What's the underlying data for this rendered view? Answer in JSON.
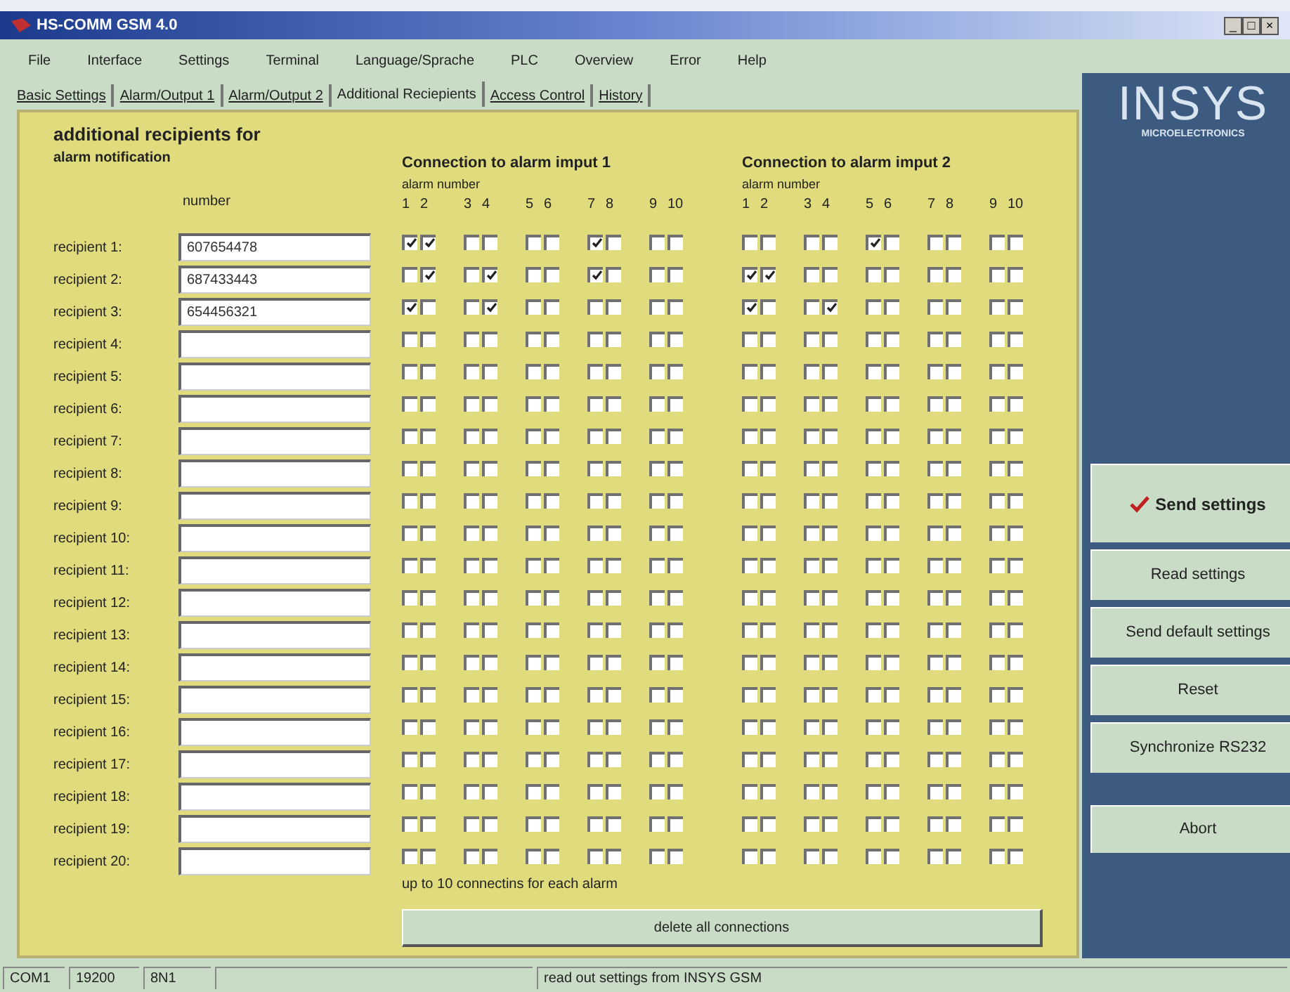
{
  "window": {
    "title": "HS-COMM GSM 4.0",
    "controls": [
      "_",
      "□",
      "×"
    ]
  },
  "menu": [
    "File",
    "Interface",
    "Settings",
    "Terminal",
    "Language/Sprache",
    "PLC",
    "Overview",
    "Error",
    "Help"
  ],
  "tabs": [
    {
      "label": "Basic Settings",
      "selected": false
    },
    {
      "label": "Alarm/Output 1",
      "selected": false
    },
    {
      "label": "Alarm/Output 2",
      "selected": false
    },
    {
      "label": "Additional Reciepients",
      "selected": true
    },
    {
      "label": "Access Control",
      "selected": false
    },
    {
      "label": "History",
      "selected": false
    }
  ],
  "heading": {
    "line_1": "additional recipients for",
    "line_2": "alarm notification"
  },
  "number_header": "number",
  "groups": [
    {
      "title": "Connection to alarm imput 1",
      "subtitle": "alarm number",
      "numbers": [
        "1",
        "2",
        "3",
        "4",
        "5",
        "6",
        "7",
        "8",
        "9",
        "10"
      ]
    },
    {
      "title": "Connection to alarm imput 2",
      "subtitle": "alarm number",
      "numbers": [
        "1",
        "2",
        "3",
        "4",
        "5",
        "6",
        "7",
        "8",
        "9",
        "10"
      ]
    }
  ],
  "recipients": [
    {
      "label": "recipient 1:",
      "number": "607654478",
      "connections": [
        [
          true,
          true,
          false,
          false,
          false,
          false,
          true,
          false,
          false,
          false
        ],
        [
          false,
          false,
          false,
          false,
          true,
          false,
          false,
          false,
          false,
          false
        ]
      ]
    },
    {
      "label": "recipient 2:",
      "number": "687433443",
      "connections": [
        [
          false,
          true,
          false,
          true,
          false,
          false,
          true,
          false,
          false,
          false
        ],
        [
          true,
          true,
          false,
          false,
          false,
          false,
          false,
          false,
          false,
          false
        ]
      ]
    },
    {
      "label": "recipient 3:",
      "number": "654456321",
      "connections": [
        [
          true,
          false,
          false,
          true,
          false,
          false,
          false,
          false,
          false,
          false
        ],
        [
          true,
          false,
          false,
          true,
          false,
          false,
          false,
          false,
          false,
          false
        ]
      ]
    },
    {
      "label": "recipient 4:",
      "connections": [
        [
          false,
          false,
          false,
          false,
          false,
          false,
          false,
          false,
          false,
          false
        ],
        [
          false,
          false,
          false,
          false,
          false,
          false,
          false,
          false,
          false,
          false
        ]
      ]
    },
    {
      "label": "recipient 5:",
      "connections": [
        [
          false,
          false,
          false,
          false,
          false,
          false,
          false,
          false,
          false,
          false
        ],
        [
          false,
          false,
          false,
          false,
          false,
          false,
          false,
          false,
          false,
          false
        ]
      ]
    },
    {
      "label": "recipient 6:",
      "connections": [
        [
          false,
          false,
          false,
          false,
          false,
          false,
          false,
          false,
          false,
          false
        ],
        [
          false,
          false,
          false,
          false,
          false,
          false,
          false,
          false,
          false,
          false
        ]
      ]
    },
    {
      "label": "recipient 7:",
      "connections": [
        [
          false,
          false,
          false,
          false,
          false,
          false,
          false,
          false,
          false,
          false
        ],
        [
          false,
          false,
          false,
          false,
          false,
          false,
          false,
          false,
          false,
          false
        ]
      ]
    },
    {
      "label": "recipient 8:",
      "connections": [
        [
          false,
          false,
          false,
          false,
          false,
          false,
          false,
          false,
          false,
          false
        ],
        [
          false,
          false,
          false,
          false,
          false,
          false,
          false,
          false,
          false,
          false
        ]
      ]
    },
    {
      "label": "recipient 9:",
      "connections": [
        [
          false,
          false,
          false,
          false,
          false,
          false,
          false,
          false,
          false,
          false
        ],
        [
          false,
          false,
          false,
          false,
          false,
          false,
          false,
          false,
          false,
          false
        ]
      ]
    },
    {
      "label": "recipient 10:",
      "connections": [
        [
          false,
          false,
          false,
          false,
          false,
          false,
          false,
          false,
          false,
          false
        ],
        [
          false,
          false,
          false,
          false,
          false,
          false,
          false,
          false,
          false,
          false
        ]
      ]
    },
    {
      "label": "recipient 11:",
      "connections": [
        [
          false,
          false,
          false,
          false,
          false,
          false,
          false,
          false,
          false,
          false
        ],
        [
          false,
          false,
          false,
          false,
          false,
          false,
          false,
          false,
          false,
          false
        ]
      ]
    },
    {
      "label": "recipient 12:",
      "connections": [
        [
          false,
          false,
          false,
          false,
          false,
          false,
          false,
          false,
          false,
          false
        ],
        [
          false,
          false,
          false,
          false,
          false,
          false,
          false,
          false,
          false,
          false
        ]
      ]
    },
    {
      "label": "recipient 13:",
      "connections": [
        [
          false,
          false,
          false,
          false,
          false,
          false,
          false,
          false,
          false,
          false
        ],
        [
          false,
          false,
          false,
          false,
          false,
          false,
          false,
          false,
          false,
          false
        ]
      ]
    },
    {
      "label": "recipient 14:",
      "connections": [
        [
          false,
          false,
          false,
          false,
          false,
          false,
          false,
          false,
          false,
          false
        ],
        [
          false,
          false,
          false,
          false,
          false,
          false,
          false,
          false,
          false,
          false
        ]
      ]
    },
    {
      "label": "recipient 15:",
      "connections": [
        [
          false,
          false,
          false,
          false,
          false,
          false,
          false,
          false,
          false,
          false
        ],
        [
          false,
          false,
          false,
          false,
          false,
          false,
          false,
          false,
          false,
          false
        ]
      ]
    },
    {
      "label": "recipient 16:",
      "connections": [
        [
          false,
          false,
          false,
          false,
          false,
          false,
          false,
          false,
          false,
          false
        ],
        [
          false,
          false,
          false,
          false,
          false,
          false,
          false,
          false,
          false,
          false
        ]
      ]
    },
    {
      "label": "recipient 17:",
      "connections": [
        [
          false,
          false,
          false,
          false,
          false,
          false,
          false,
          false,
          false,
          false
        ],
        [
          false,
          false,
          false,
          false,
          false,
          false,
          false,
          false,
          false,
          false
        ]
      ]
    },
    {
      "label": "recipient 18:",
      "connections": [
        [
          false,
          false,
          false,
          false,
          false,
          false,
          false,
          false,
          false,
          false
        ],
        [
          false,
          false,
          false,
          false,
          false,
          false,
          false,
          false,
          false,
          false
        ]
      ]
    },
    {
      "label": "recipient 19:",
      "connections": [
        [
          false,
          false,
          false,
          false,
          false,
          false,
          false,
          false,
          false,
          false
        ],
        [
          false,
          false,
          false,
          false,
          false,
          false,
          false,
          false,
          false,
          false
        ]
      ]
    },
    {
      "label": "recipient 20:",
      "connections": [
        [
          false,
          false,
          false,
          false,
          false,
          false,
          false,
          false,
          false,
          false
        ],
        [
          false,
          false,
          false,
          false,
          false,
          false,
          false,
          false,
          false,
          false
        ]
      ]
    }
  ],
  "note": "up to 10 connectins for each alarm",
  "delete_button": "delete all connections",
  "logo": {
    "name": "INSYS",
    "tagline": "MICROELECTRONICS"
  },
  "actions": [
    {
      "label": "Send settings",
      "kind": "primary"
    },
    {
      "label": "Read settings",
      "kind": "normal"
    },
    {
      "label": "Send default settings",
      "kind": "normal"
    },
    {
      "label": "Reset",
      "kind": "normal"
    },
    {
      "label": "Synchronize RS232",
      "kind": "normal"
    },
    {
      "label": "Abort",
      "kind": "separate"
    }
  ],
  "status_bar": {
    "port": "COM1",
    "baud": "19200",
    "format": "8N1",
    "message": "read out settings from INSYS GSM"
  }
}
